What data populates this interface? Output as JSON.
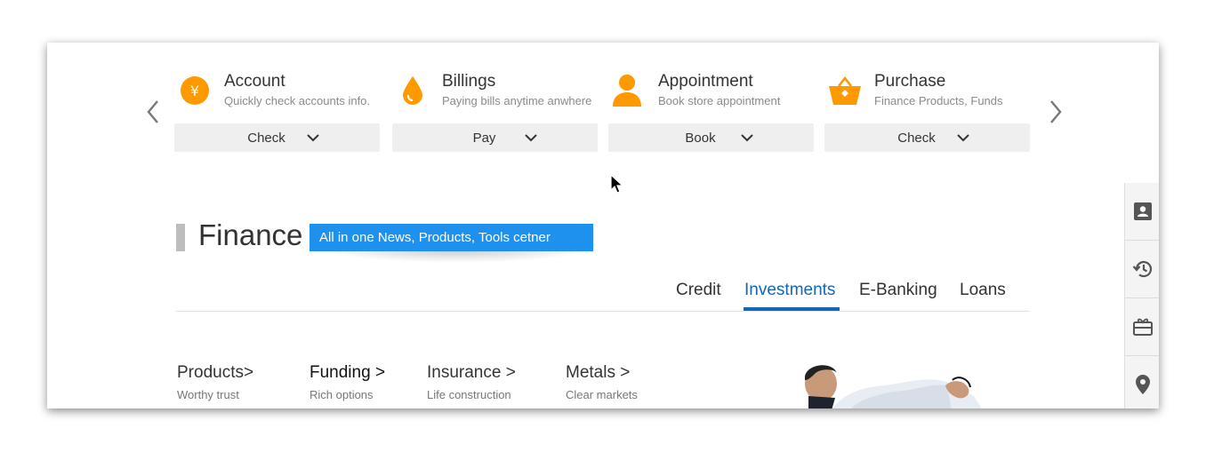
{
  "services": [
    {
      "title": "Account",
      "subtitle": "Quickly check accounts info.",
      "button": "Check",
      "icon": "yen-coin-icon"
    },
    {
      "title": "Billings",
      "subtitle": "Paying bills anytime anwhere",
      "button": "Pay",
      "icon": "drop-icon"
    },
    {
      "title": "Appointment",
      "subtitle": "Book store appointment",
      "button": "Book",
      "icon": "user-icon"
    },
    {
      "title": "Purchase",
      "subtitle": "Finance Products, Funds",
      "button": "Check",
      "icon": "basket-icon"
    }
  ],
  "accent_color": "#ff9900",
  "finance": {
    "title": "Finance",
    "banner": "All in one News, Products, Tools cetner"
  },
  "tabs": [
    {
      "label": "Credit",
      "active": false
    },
    {
      "label": "Investments",
      "active": true
    },
    {
      "label": "E-Banking",
      "active": false
    },
    {
      "label": "Loans",
      "active": false
    }
  ],
  "categories": [
    {
      "title": "Products>",
      "subtitle": "Worthy trust"
    },
    {
      "title": "Funding >",
      "subtitle": "Rich options"
    },
    {
      "title": "Insurance >",
      "subtitle": "Life construction"
    },
    {
      "title": "Metals >",
      "subtitle": "Clear markets"
    }
  ],
  "dock_icons": [
    "contact-card-icon",
    "history-icon",
    "gift-card-icon",
    "location-pin-icon"
  ],
  "brand_blue": "#1e90ee",
  "tab_active_color": "#1366b8"
}
